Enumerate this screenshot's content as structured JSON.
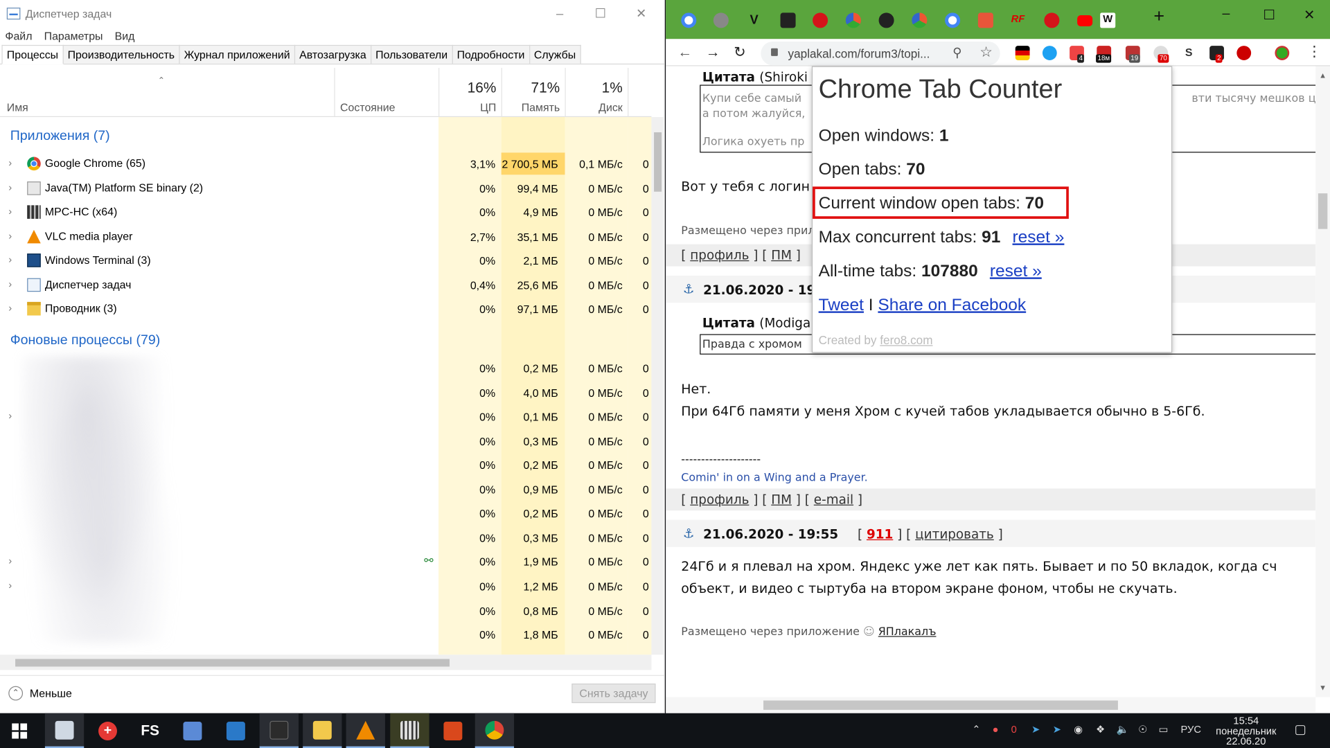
{
  "task_manager": {
    "title": "Диспетчер задач",
    "menu": [
      "Файл",
      "Параметры",
      "Вид"
    ],
    "tabs": [
      "Процессы",
      "Производительность",
      "Журнал приложений",
      "Автозагрузка",
      "Пользователи",
      "Подробности",
      "Службы"
    ],
    "columns": {
      "name": "Имя",
      "status": "Состояние",
      "cpu_pct": "16%",
      "cpu": "ЦП",
      "mem_pct": "71%",
      "mem": "Память",
      "disk_pct": "1%",
      "disk": "Диск"
    },
    "apps_group": "Приложения (7)",
    "apps": [
      {
        "name": "Google Chrome (65)",
        "cpu": "3,1%",
        "mem": "2 700,5 МБ",
        "disk": "0,1 МБ/с",
        "net": "0"
      },
      {
        "name": "Java(TM) Platform SE binary (2)",
        "cpu": "0%",
        "mem": "99,4 МБ",
        "disk": "0 МБ/с",
        "net": "0"
      },
      {
        "name": "MPC-HC (x64)",
        "cpu": "0%",
        "mem": "4,9 МБ",
        "disk": "0 МБ/с",
        "net": "0"
      },
      {
        "name": "VLC media player",
        "cpu": "2,7%",
        "mem": "35,1 МБ",
        "disk": "0 МБ/с",
        "net": "0"
      },
      {
        "name": "Windows Terminal (3)",
        "cpu": "0%",
        "mem": "2,1 МБ",
        "disk": "0 МБ/с",
        "net": "0"
      },
      {
        "name": "Диспетчер задач",
        "cpu": "0,4%",
        "mem": "25,6 МБ",
        "disk": "0 МБ/с",
        "net": "0"
      },
      {
        "name": "Проводник (3)",
        "cpu": "0%",
        "mem": "97,1 МБ",
        "disk": "0 МБ/с",
        "net": "0"
      }
    ],
    "bg_group": "Фоновые процессы (79)",
    "bg": [
      {
        "cpu": "0%",
        "mem": "0,2 МБ",
        "disk": "0 МБ/с",
        "net": "0"
      },
      {
        "cpu": "0%",
        "mem": "4,0 МБ",
        "disk": "0 МБ/с",
        "net": "0"
      },
      {
        "cpu": "0%",
        "mem": "0,1 МБ",
        "disk": "0 МБ/с",
        "net": "0"
      },
      {
        "cpu": "0%",
        "mem": "0,3 МБ",
        "disk": "0 МБ/с",
        "net": "0"
      },
      {
        "cpu": "0%",
        "mem": "0,2 МБ",
        "disk": "0 МБ/с",
        "net": "0"
      },
      {
        "cpu": "0%",
        "mem": "0,9 МБ",
        "disk": "0 МБ/с",
        "net": "0"
      },
      {
        "cpu": "0%",
        "mem": "0,2 МБ",
        "disk": "0 МБ/с",
        "net": "0"
      },
      {
        "cpu": "0%",
        "mem": "0,3 МБ",
        "disk": "0 МБ/с",
        "net": "0"
      },
      {
        "cpu": "0%",
        "mem": "1,9 МБ",
        "disk": "0 МБ/с",
        "net": "0"
      },
      {
        "cpu": "0%",
        "mem": "1,2 МБ",
        "disk": "0 МБ/с",
        "net": "0"
      },
      {
        "cpu": "0%",
        "mem": "0,8 МБ",
        "disk": "0 МБ/с",
        "net": "0"
      },
      {
        "cpu": "0%",
        "mem": "1,8 МБ",
        "disk": "0 МБ/с",
        "net": "0"
      }
    ],
    "less_label": "Меньше",
    "end_task_label": "Снять задачу"
  },
  "chrome": {
    "url": "yaplakal.com/forum3/topi...",
    "badges": {
      "b1": "4",
      "b2": "18м",
      "b3": "19",
      "b4": "70",
      "b5": "2"
    },
    "page": {
      "quote1_label": "Цитата",
      "quote1_author": "(Shiroki",
      "quote1_line1": "Купи себе самый",
      "quote1_line1_right": "вти тысячу мешков цем",
      "quote1_line2": "а потом жалуйся,",
      "quote1_line3": "Логика охуеть пр",
      "post1_text": "Вот у тебя с логин",
      "posted_via1": "Размещено через прилож",
      "links1": [
        "профиль",
        "ПМ"
      ],
      "post2_date": "21.06.2020 - 19",
      "quote2_label": "Цитата",
      "quote2_author": "(Modiga",
      "quote2_line1": "Правда с хромом",
      "post2_line1": "Нет.",
      "post2_line2": "При 64Гб памяти у меня Хром с кучей табов укладывается обычно в 5-6Гб.",
      "signature_dashes": "--------------------",
      "signature": "Comin' in on a Wing and a Prayer.",
      "links2": [
        "профиль",
        "ПМ",
        "e-mail"
      ],
      "post3_date": "21.06.2020 - 19:55",
      "post3_rating": "911",
      "post3_quote": "цитировать",
      "post3_line1": "24Гб и я плевал на хром. Яндекс уже лет как пять. Бывает и по 50 вкладок, когда сч",
      "post3_line2": "объект, и видео с тыртуба на втором экране фоном, чтобы не скучать.",
      "posted_via3": "Размещено через приложение",
      "app_link": "ЯПлакалъ"
    },
    "popup": {
      "title": "Chrome Tab Counter",
      "open_windows_label": "Open windows:",
      "open_windows": "1",
      "open_tabs_label": "Open tabs:",
      "open_tabs": "70",
      "current_label": "Current window open tabs:",
      "current": "70",
      "max_label": "Max concurrent tabs:",
      "max": "91",
      "alltime_label": "All-time tabs:",
      "alltime": "107880",
      "reset": "reset »",
      "tweet": "Tweet",
      "sep": "I",
      "facebook": "Share on Facebook",
      "created_label": "Created by",
      "created_link": "fero8.com"
    }
  },
  "taskbar": {
    "fs_label": "FS",
    "tray_count": "0",
    "lang": "РУС",
    "time": "15:54",
    "day": "понедельник",
    "date": "22.06.20"
  },
  "colors": {
    "accent": "#1f66c7",
    "highlight_box": "#e01010",
    "chrome_frame": "#5aa53d"
  }
}
